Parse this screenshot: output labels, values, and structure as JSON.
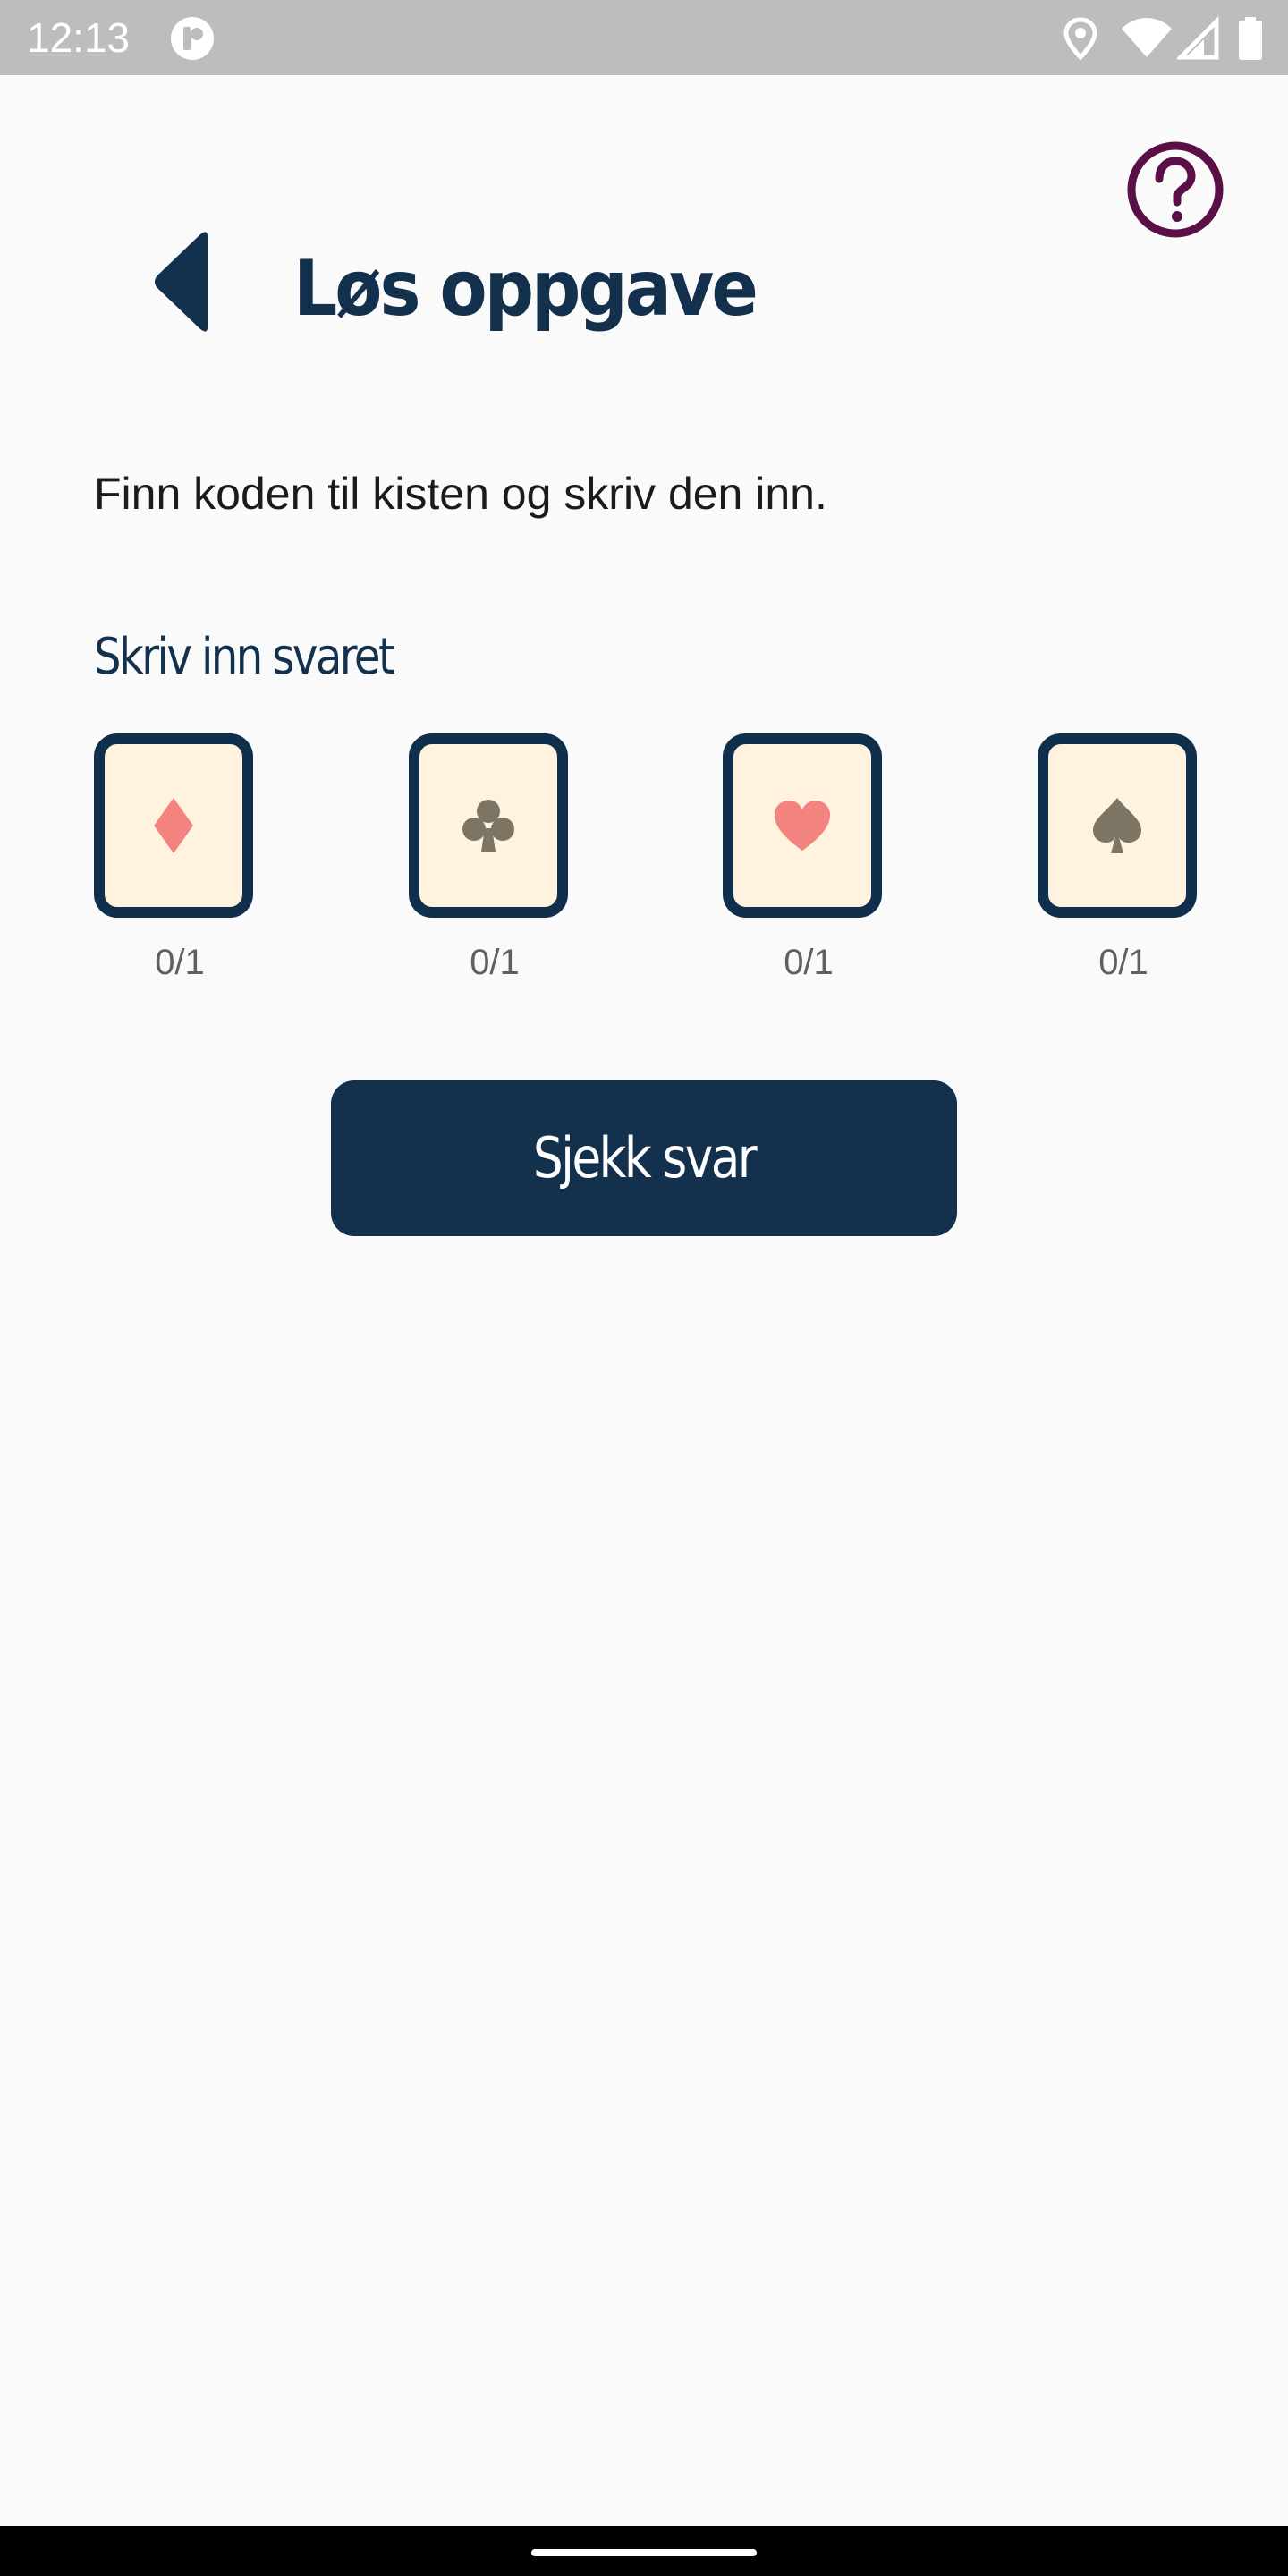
{
  "status_bar": {
    "time": "12:13",
    "icons": [
      "app-notification-icon",
      "location-icon",
      "wifi-icon",
      "cellular-signal-icon",
      "battery-icon"
    ]
  },
  "header": {
    "title": "Løs oppgave",
    "back_icon": "back-arrow-icon",
    "help_icon": "help-question-icon"
  },
  "instruction": "Finn koden til kisten og skriv den inn.",
  "answer": {
    "label": "Skriv inn svaret",
    "slots": [
      {
        "suit": "diamond",
        "counter": "0/1",
        "color": "#f3837f"
      },
      {
        "suit": "club",
        "counter": "0/1",
        "color": "#7d7563"
      },
      {
        "suit": "heart",
        "counter": "0/1",
        "color": "#f3837f"
      },
      {
        "suit": "spade",
        "counter": "0/1",
        "color": "#7d7563"
      }
    ]
  },
  "check_button": {
    "label": "Sjekk svar"
  },
  "colors": {
    "primary": "#13304d",
    "card_background": "#fff3df",
    "help_icon": "#5a1047",
    "background": "#fafafa"
  }
}
